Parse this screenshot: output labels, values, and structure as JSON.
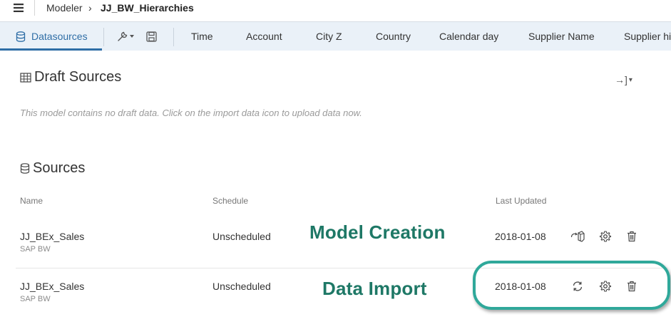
{
  "topbar": {
    "breadcrumb_root": "Modeler",
    "breadcrumb_separator": "›",
    "model_name": "JJ_BW_Hierarchies"
  },
  "toolbar": {
    "active_tab": "Datasources",
    "dimension_tabs": [
      "Time",
      "Account",
      "City Z",
      "Country",
      "Calendar day",
      "Supplier Name",
      "Supplier hip"
    ],
    "tools": [
      "wrench-dropdown-icon",
      "save-icon"
    ]
  },
  "draft": {
    "title": "Draft Sources",
    "message": "This model contains no draft data. Click on the import data icon to upload data now.",
    "import_arrow": "→]",
    "import_caret": "▾"
  },
  "sources": {
    "title": "Sources",
    "columns": {
      "name": "Name",
      "schedule": "Schedule",
      "last_updated": "Last Updated"
    },
    "rows": [
      {
        "name": "JJ_BEx_Sales",
        "system": "SAP BW",
        "schedule": "Unscheduled",
        "last_updated": "2018-01-08",
        "actions": [
          "model-refresh-icon",
          "settings-icon",
          "delete-icon"
        ]
      },
      {
        "name": "JJ_BEx_Sales",
        "system": "SAP BW",
        "schedule": "Unscheduled",
        "last_updated": "2018-01-08",
        "actions": [
          "refresh-icon",
          "settings-icon",
          "delete-icon"
        ]
      }
    ]
  },
  "annotations": {
    "model_creation": "Model Creation",
    "data_import": "Data Import",
    "color": "#1e7866",
    "highlight_color": "#2fa89a"
  },
  "colors": {
    "accent": "#2f6ea6",
    "toolbar_bg": "#eaf1f8"
  }
}
